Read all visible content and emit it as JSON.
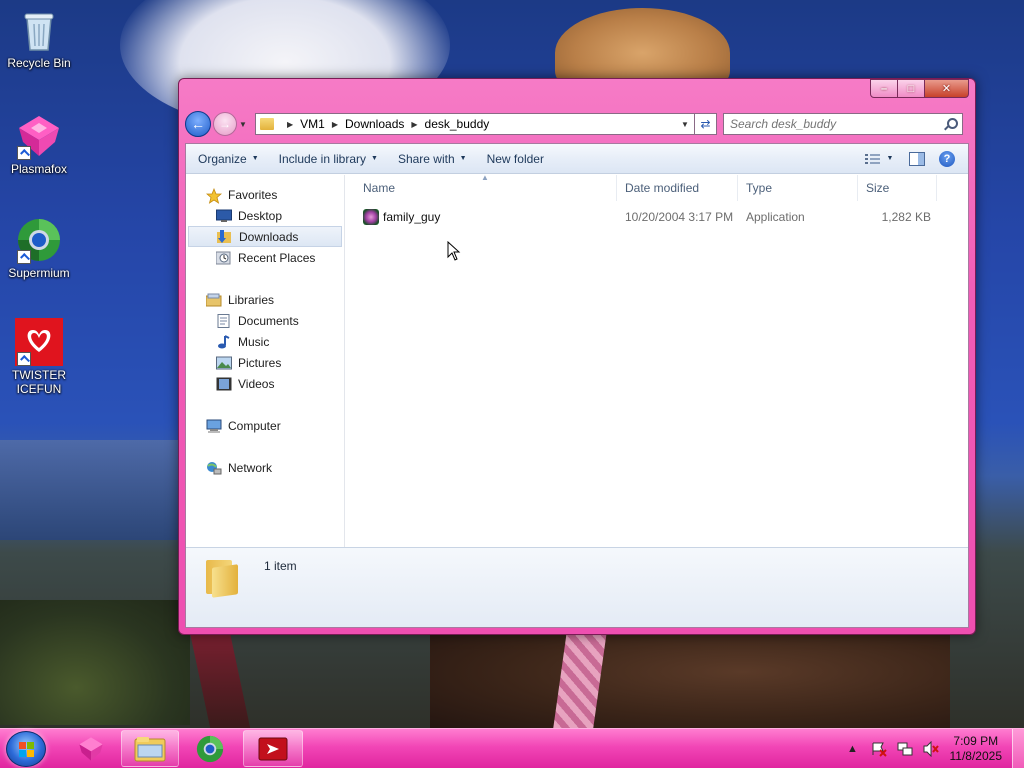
{
  "desktop": {
    "icons": [
      {
        "label": "Recycle Bin",
        "icon": "recycle-bin-icon"
      },
      {
        "label": "Plasmafox",
        "icon": "plasmafox-icon"
      },
      {
        "label": "Supermium",
        "icon": "supermium-icon"
      },
      {
        "label": "TWISTER ICEFUN",
        "icon": "twister-icefun-icon"
      }
    ]
  },
  "window": {
    "controls": {
      "minimize": "–",
      "maximize": "□",
      "close": "✕"
    },
    "address": {
      "crumbs": [
        "VM1",
        "Downloads",
        "desk_buddy"
      ]
    },
    "search": {
      "placeholder": "Search desk_buddy"
    },
    "toolbar": {
      "organize": "Organize",
      "include_in_library": "Include in library",
      "share_with": "Share with",
      "new_folder": "New folder"
    },
    "nav": {
      "favorites": "Favorites",
      "desktop": "Desktop",
      "downloads": "Downloads",
      "recent_places": "Recent Places",
      "libraries": "Libraries",
      "documents": "Documents",
      "music": "Music",
      "pictures": "Pictures",
      "videos": "Videos",
      "computer": "Computer",
      "network": "Network",
      "selected": "Downloads"
    },
    "columns": {
      "name": "Name",
      "date": "Date modified",
      "type": "Type",
      "size": "Size"
    },
    "files": [
      {
        "name": "family_guy",
        "date": "10/20/2004 3:17 PM",
        "type": "Application",
        "size": "1,282 KB",
        "icon": "application-icon"
      }
    ],
    "details": {
      "count": "1 item"
    }
  },
  "taskbar": {
    "pinned": [
      "plasmafox-icon",
      "windows-explorer-icon",
      "supermium-icon",
      "acrobat-icon"
    ],
    "clock": {
      "time": "7:09 PM",
      "date": "11/8/2025"
    }
  },
  "colors": {
    "accent": "#ee4fb0",
    "taskbar": "#f246b6",
    "desktop_blue": "#2546a8"
  }
}
